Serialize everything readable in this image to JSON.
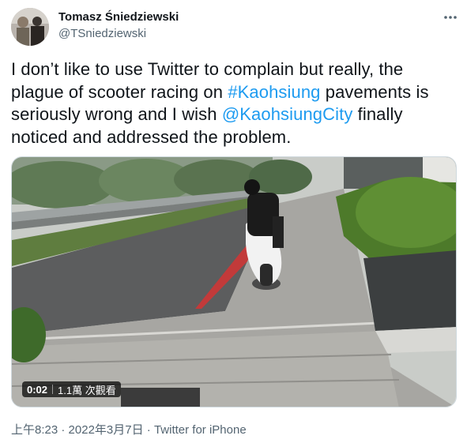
{
  "user": {
    "name": "Tomasz Śniedziewski",
    "handle": "@TSniedziewski"
  },
  "tweet": {
    "text_part1": "I don’t like to use Twitter to complain but really, the plague of scooter racing on ",
    "hashtag": "#Kaohsiung",
    "text_part2": " pavements is seriously wrong and I wish ",
    "mention": "@KaohsiungCity",
    "text_part3": " finally noticed and addressed the problem."
  },
  "video": {
    "duration": "0:02",
    "views": "1.1萬 次觀看"
  },
  "meta": {
    "time": "上午8:23",
    "separator1": " · ",
    "date": "2022年3月7日",
    "separator2": " · ",
    "source": "Twitter for iPhone"
  },
  "colors": {
    "link": "#1d9bf0",
    "secondary_text": "#536471"
  },
  "icons": {
    "more": "more-dots-icon",
    "avatar": "avatar"
  }
}
